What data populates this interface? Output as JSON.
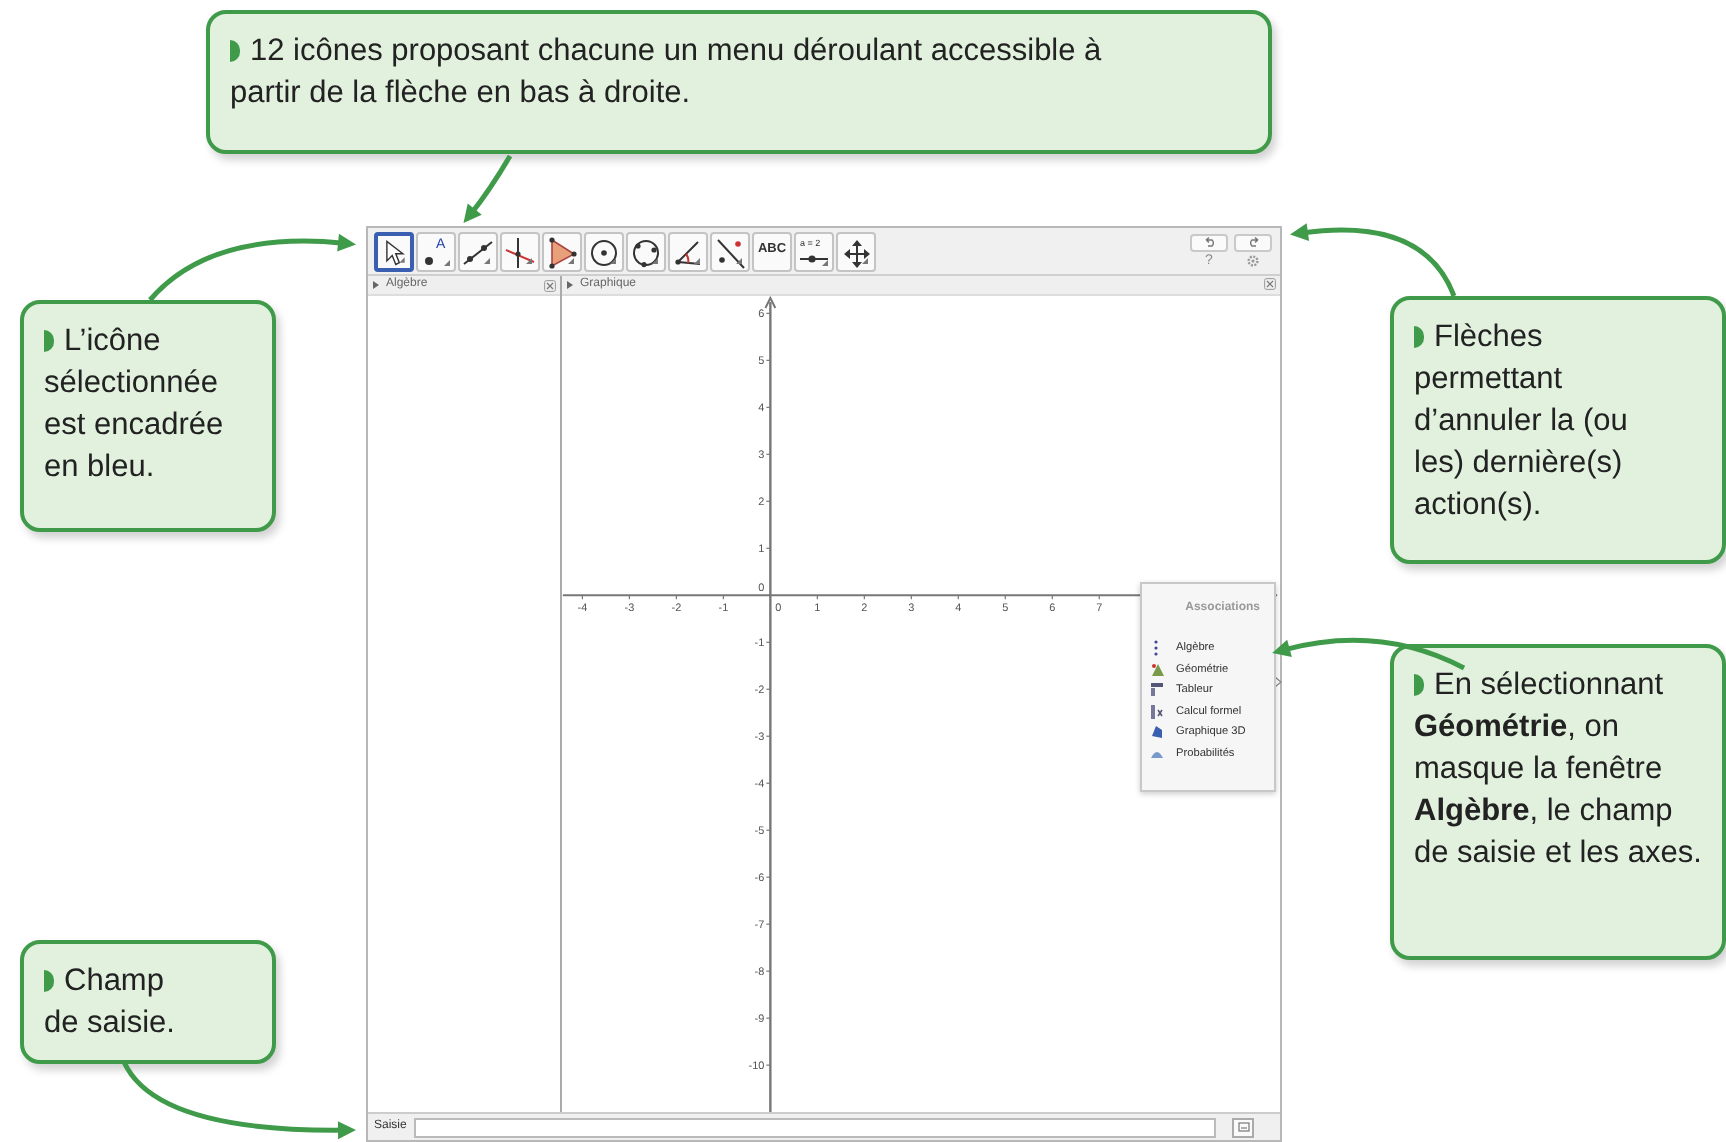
{
  "window": {
    "toolbar": {
      "tools": [
        {
          "selected": true
        },
        {
          "selected": false,
          "label": "A"
        },
        {
          "selected": false
        },
        {
          "selected": false
        },
        {
          "selected": false
        },
        {
          "selected": false
        },
        {
          "selected": false
        },
        {
          "selected": false
        },
        {
          "selected": false
        },
        {
          "selected": false,
          "label": "ABC"
        },
        {
          "selected": false,
          "label": "a = 2"
        },
        {
          "selected": false
        }
      ],
      "help": "?"
    },
    "algebra_panel": {
      "title": "Algèbre"
    },
    "graphics_panel": {
      "title": "Graphique",
      "x_tick_labels": [
        "-4",
        "-3",
        "-2",
        "-1",
        "0",
        "1",
        "2",
        "3",
        "4",
        "5",
        "6",
        "7"
      ],
      "y_tick_labels": [
        "6",
        "5",
        "4",
        "3",
        "2",
        "1",
        "0",
        "-1",
        "-2",
        "-3",
        "-4",
        "-5",
        "-6",
        "-7",
        "-8",
        "-9",
        "-10"
      ]
    },
    "perspectives_menu": {
      "title": "Associations",
      "items": [
        "Algèbre",
        "Géométrie",
        "Tableur",
        "Calcul formel",
        "Graphique 3D",
        "Probabilités"
      ]
    },
    "input_bar": {
      "label": "Saisie"
    }
  },
  "callouts": [
    {
      "text": "12 icônes proposant chacune un menu déroulant accessible à partir de la flèche en bas à droite."
    },
    {
      "text": "L’icône sélectionnée est encadrée en bleu."
    },
    {
      "text": "Flèches permettant d’annuler la (ou les) dernière(s) action(s)."
    },
    {
      "text": "En sélectionnant **Géométrie**, on masque la fenêtre **Algèbre**, le champ de saisie et les axes."
    },
    {
      "text": "Champ de saisie."
    }
  ]
}
